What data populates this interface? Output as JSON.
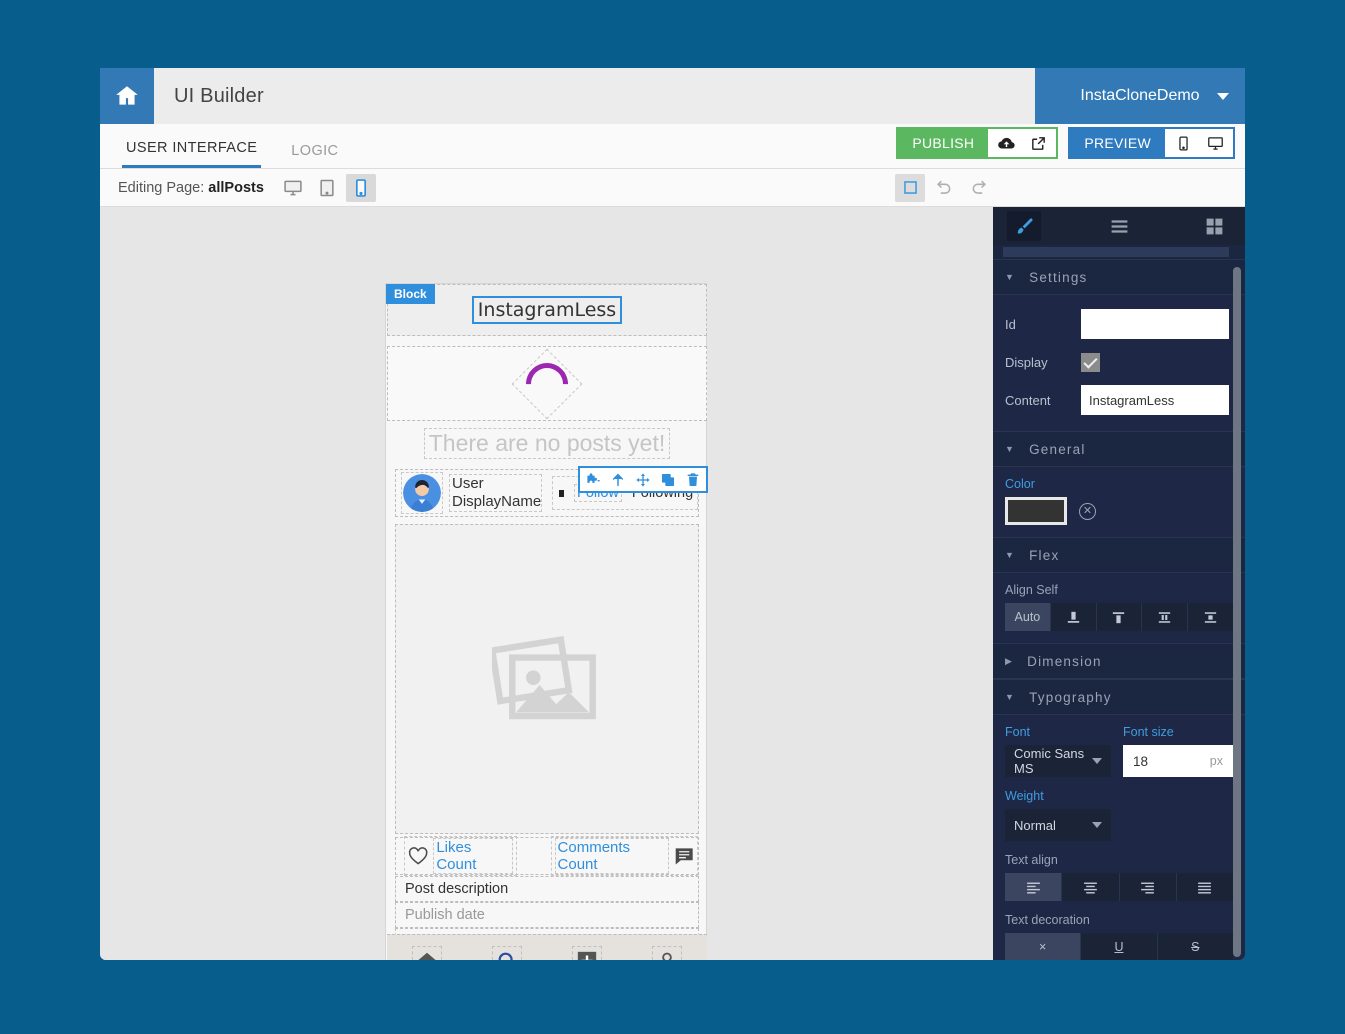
{
  "titlebar": {
    "home_icon": "home-icon",
    "app_title": "UI Builder",
    "project_name": "InstaCloneDemo"
  },
  "tabs": [
    {
      "label": "USER INTERFACE",
      "active": true
    },
    {
      "label": "LOGIC",
      "active": false
    }
  ],
  "actions": {
    "publish_label": "PUBLISH",
    "publish_icons": [
      "cloud-upload-icon",
      "external-link-icon"
    ],
    "publish_color": "#5cb860",
    "preview_label": "PREVIEW",
    "preview_icons": [
      "mobile-icon",
      "desktop-icon"
    ],
    "preview_color": "#2f7bbf"
  },
  "editor_toolbar": {
    "editing_prefix": "Editing Page:",
    "page_name": "allPosts",
    "devices": [
      {
        "name": "desktop-icon",
        "active": false
      },
      {
        "name": "tablet-icon",
        "active": false
      },
      {
        "name": "mobile-icon",
        "active": true
      }
    ],
    "right_tools": [
      {
        "name": "selection-box-icon",
        "active": true
      },
      {
        "name": "undo-icon",
        "active": false
      },
      {
        "name": "redo-icon",
        "active": false
      }
    ]
  },
  "canvas": {
    "block_badge": "Block",
    "selected_title": "InstagramLess",
    "element_toolbar_icons": [
      "component-puzzle-icon",
      "select-parent-arrow-icon",
      "move-drag-icon",
      "duplicate-icon",
      "delete-trash-icon"
    ],
    "spinner": "loading-spinner",
    "spinner_color": "#9c27b0",
    "no_posts_text": "There are no posts yet!",
    "user_display_name": "User DisplayName",
    "follow_label": "Follow",
    "following_label": "Following",
    "image_placeholder": "image-placeholder-icon",
    "likes_label": "Likes Count",
    "likes_icon": "heart-icon",
    "comments_label": "Comments Count",
    "comments_icon": "comment-bubble-icon",
    "post_description": "Post description",
    "publish_date": "Publish date",
    "bottom_nav": [
      "home-icon",
      "search-icon",
      "add-plus-icon",
      "profile-person-icon"
    ]
  },
  "panel": {
    "header_icons": [
      {
        "name": "brush-icon",
        "active": true
      },
      {
        "name": "hamburger-menu-icon",
        "active": false
      },
      {
        "name": "grid-layout-icon",
        "active": false
      }
    ],
    "sections": {
      "settings": {
        "title": "Settings",
        "expanded": true,
        "id_label": "Id",
        "id_value": "",
        "display_label": "Display",
        "display_checked": true,
        "content_label": "Content",
        "content_value": "InstagramLess"
      },
      "general": {
        "title": "General",
        "expanded": true,
        "color_label": "Color",
        "color_value": "#333333",
        "color_clear_icon": "clear-circle-icon"
      },
      "flex": {
        "title": "Flex",
        "expanded": true,
        "align_self_label": "Align Self",
        "align_self_options": [
          {
            "label": "Auto",
            "active": true
          },
          {
            "label": "flex-start",
            "active": false
          },
          {
            "label": "flex-end",
            "active": false
          },
          {
            "label": "stretch",
            "active": false
          },
          {
            "label": "center",
            "active": false
          }
        ]
      },
      "dimension": {
        "title": "Dimension",
        "expanded": false
      },
      "typography": {
        "title": "Typography",
        "expanded": true,
        "font_label": "Font",
        "font_value": "Comic Sans MS",
        "font_size_label": "Font size",
        "font_size_value": "18",
        "font_size_unit": "px",
        "weight_label": "Weight",
        "weight_value": "Normal",
        "text_align_label": "Text align",
        "text_align_options": [
          {
            "name": "align-left-icon",
            "active": true
          },
          {
            "name": "align-center-icon",
            "active": false
          },
          {
            "name": "align-right-icon",
            "active": false
          },
          {
            "name": "align-justify-icon",
            "active": false
          }
        ],
        "text_decoration_label": "Text decoration",
        "text_decoration_options": [
          {
            "name": "decoration-none-icon",
            "label": "×",
            "active": true
          },
          {
            "name": "underline-icon",
            "label": "U",
            "active": false
          },
          {
            "name": "strikethrough-icon",
            "label": "S",
            "active": false
          }
        ]
      }
    }
  }
}
